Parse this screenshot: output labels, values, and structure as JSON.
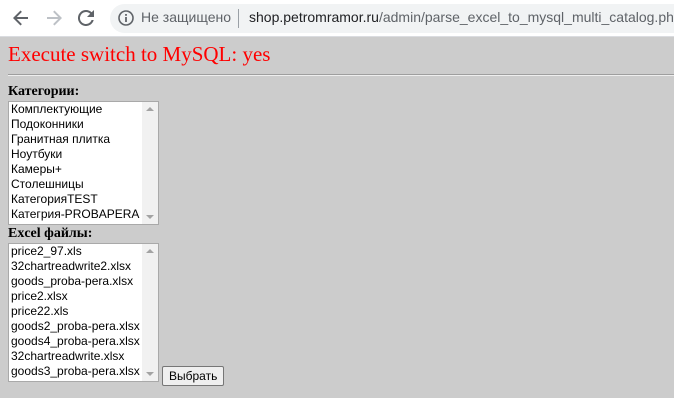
{
  "browser": {
    "security_label": "Не защищено",
    "url_host": "shop.petromramor.ru",
    "url_path": "/admin/parse_excel_to_mysql_multi_catalog.php"
  },
  "page": {
    "status_text": "Execute switch to MySQL: yes",
    "categories_label": "Категории:",
    "categories": [
      "Комплектующие",
      "Подоконники",
      "Гранитная плитка",
      "Ноутбуки",
      "Камеры+",
      "Столешницы",
      "КатегорияTEST",
      "Категрия-PROBAPERA"
    ],
    "files_label": "Excel файлы:",
    "files": [
      "price2_97.xls",
      "32chartreadwrite2.xlsx",
      "goods_proba-pera.xlsx",
      "price2.xlsx",
      "price22.xls",
      "goods2_proba-pera.xlsx",
      "goods4_proba-pera.xlsx",
      "32chartreadwrite.xlsx",
      "goods3_proba-pera.xlsx"
    ],
    "submit_label": "Выбрать"
  }
}
